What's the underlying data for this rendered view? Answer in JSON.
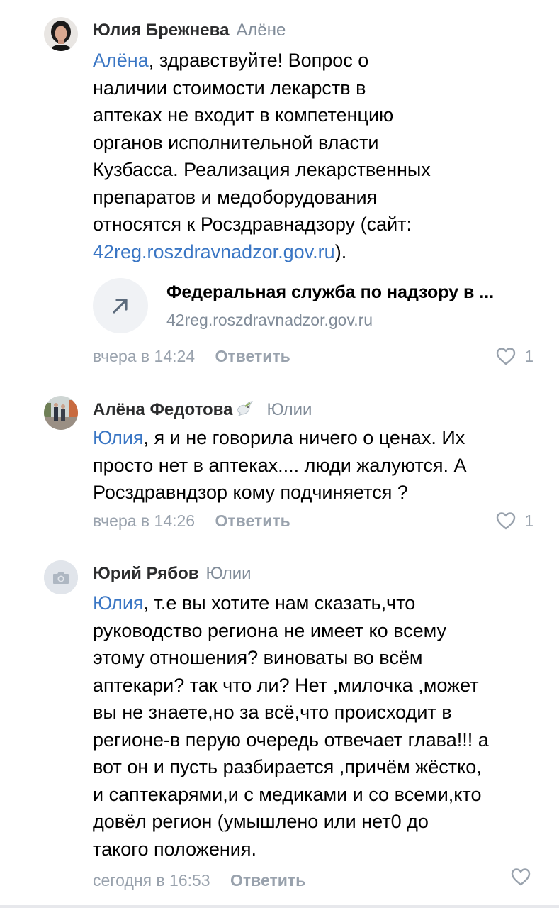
{
  "comments": [
    {
      "author": "Юлия Брежнева",
      "reply_to": "Алёне",
      "mention": "Алёна",
      "text_lines": [
        ", здравствуйте! Вопрос о",
        "наличии стоимости лекарств в",
        "аптеках не входит в компетенцию",
        "органов исполнительной власти",
        "Кузбасса. Реализация лекарственных",
        "препаратов и медоборудования",
        "относятся к Росздравнадзору (сайт:"
      ],
      "link": "42reg.roszdravnadzor.gov.ru",
      "after_link": ").",
      "snippet": {
        "title": "Федеральная служба по надзору в ...",
        "url": "42reg.roszdravnadzor.gov.ru",
        "icon": "arrow-up-right-icon"
      },
      "time": "вчера в 14:24",
      "reply_label": "Ответить",
      "likes": "1"
    },
    {
      "author": "Алёна Федотова",
      "author_badge": "dove-emoji",
      "reply_to": "Юлии",
      "mention": "Юлия",
      "text_lines": [
        ", я и не говорила ничего о ценах. Их",
        "просто нет в аптеках.... люди жалуются. А",
        "Росздравндзор кому подчиняется ?"
      ],
      "time": "вчера в 14:26",
      "reply_label": "Ответить",
      "likes": "1"
    },
    {
      "author": "Юрий Рябов",
      "reply_to": "Юлии",
      "mention": "Юлия",
      "avatar_icon": "camera-icon",
      "text_lines": [
        ", т.е вы хотите нам сказать,что",
        "руководство региона не имеет ко всему",
        "этому отношения? виноваты во всём",
        "аптекари? так что ли? Нет ,милочка ,может",
        "вы не знаете,но за всё,что происходит в",
        "регионе-в перую очередь отвечает глава!!! а",
        "вот он и пусть разбирается ,причём жёстко,",
        "и саптекарями,и с медиками и со всеми,кто",
        "довёл регион (умышлено или нет0 до",
        "такого положения."
      ],
      "time": "сегодня в 16:53",
      "reply_label": "Ответить",
      "likes": ""
    }
  ]
}
